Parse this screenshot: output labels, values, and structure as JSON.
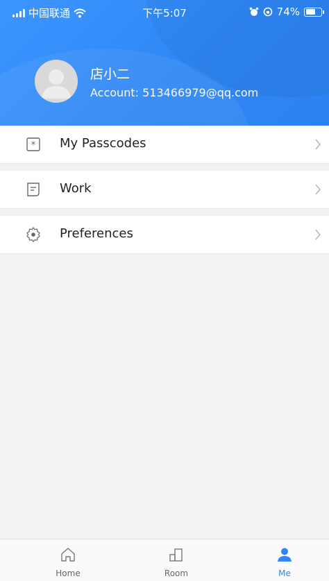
{
  "status_bar": {
    "carrier": "中国联通",
    "time": "下午5:07",
    "battery": "74%",
    "battery_level": 0.74
  },
  "profile": {
    "name": "店小二",
    "account": "Account: 513466979@qq.com"
  },
  "menu": {
    "items": [
      {
        "label": "My Passcodes",
        "icon": "passcode-icon"
      },
      {
        "label": "Work",
        "icon": "document-icon"
      },
      {
        "label": "Preferences",
        "icon": "settings-gear-icon"
      }
    ]
  },
  "tabbar": {
    "tabs": [
      {
        "label": "Home",
        "icon": "home-icon",
        "active": false
      },
      {
        "label": "Room",
        "icon": "building-icon",
        "active": false
      },
      {
        "label": "Me",
        "icon": "user-icon",
        "active": true
      }
    ]
  },
  "colors": {
    "accent": "#2f87f5",
    "background": "#f2f2f2"
  }
}
